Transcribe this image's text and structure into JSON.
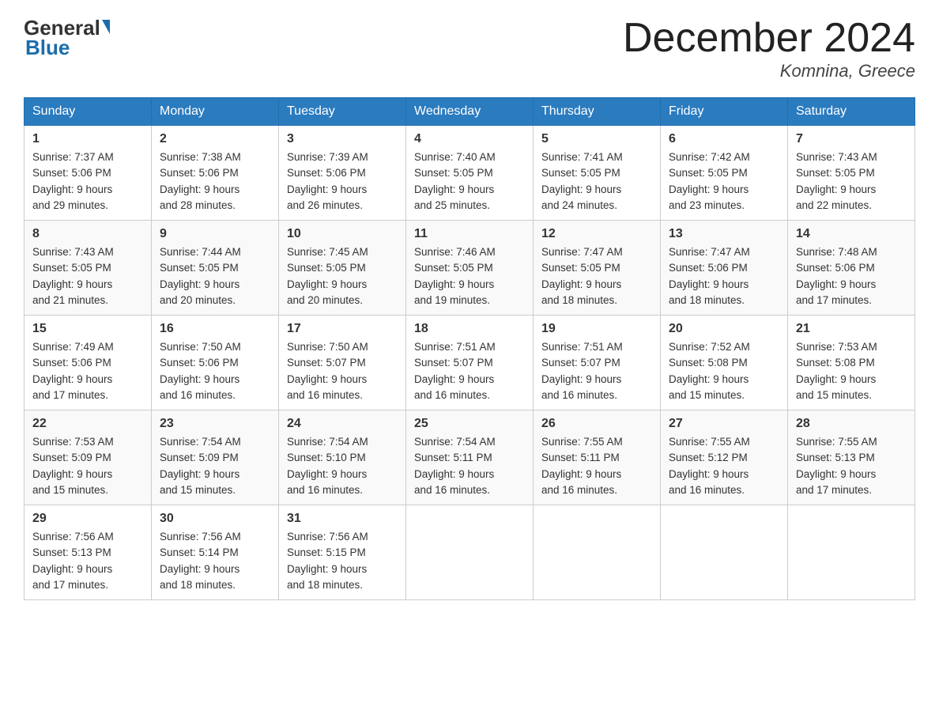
{
  "header": {
    "logo_general": "General",
    "logo_blue": "Blue",
    "month_title": "December 2024",
    "location": "Komnina, Greece"
  },
  "weekdays": [
    "Sunday",
    "Monday",
    "Tuesday",
    "Wednesday",
    "Thursday",
    "Friday",
    "Saturday"
  ],
  "weeks": [
    [
      {
        "day": "1",
        "sunrise": "Sunrise: 7:37 AM",
        "sunset": "Sunset: 5:06 PM",
        "daylight": "Daylight: 9 hours",
        "minutes": "and 29 minutes."
      },
      {
        "day": "2",
        "sunrise": "Sunrise: 7:38 AM",
        "sunset": "Sunset: 5:06 PM",
        "daylight": "Daylight: 9 hours",
        "minutes": "and 28 minutes."
      },
      {
        "day": "3",
        "sunrise": "Sunrise: 7:39 AM",
        "sunset": "Sunset: 5:06 PM",
        "daylight": "Daylight: 9 hours",
        "minutes": "and 26 minutes."
      },
      {
        "day": "4",
        "sunrise": "Sunrise: 7:40 AM",
        "sunset": "Sunset: 5:05 PM",
        "daylight": "Daylight: 9 hours",
        "minutes": "and 25 minutes."
      },
      {
        "day": "5",
        "sunrise": "Sunrise: 7:41 AM",
        "sunset": "Sunset: 5:05 PM",
        "daylight": "Daylight: 9 hours",
        "minutes": "and 24 minutes."
      },
      {
        "day": "6",
        "sunrise": "Sunrise: 7:42 AM",
        "sunset": "Sunset: 5:05 PM",
        "daylight": "Daylight: 9 hours",
        "minutes": "and 23 minutes."
      },
      {
        "day": "7",
        "sunrise": "Sunrise: 7:43 AM",
        "sunset": "Sunset: 5:05 PM",
        "daylight": "Daylight: 9 hours",
        "minutes": "and 22 minutes."
      }
    ],
    [
      {
        "day": "8",
        "sunrise": "Sunrise: 7:43 AM",
        "sunset": "Sunset: 5:05 PM",
        "daylight": "Daylight: 9 hours",
        "minutes": "and 21 minutes."
      },
      {
        "day": "9",
        "sunrise": "Sunrise: 7:44 AM",
        "sunset": "Sunset: 5:05 PM",
        "daylight": "Daylight: 9 hours",
        "minutes": "and 20 minutes."
      },
      {
        "day": "10",
        "sunrise": "Sunrise: 7:45 AM",
        "sunset": "Sunset: 5:05 PM",
        "daylight": "Daylight: 9 hours",
        "minutes": "and 20 minutes."
      },
      {
        "day": "11",
        "sunrise": "Sunrise: 7:46 AM",
        "sunset": "Sunset: 5:05 PM",
        "daylight": "Daylight: 9 hours",
        "minutes": "and 19 minutes."
      },
      {
        "day": "12",
        "sunrise": "Sunrise: 7:47 AM",
        "sunset": "Sunset: 5:05 PM",
        "daylight": "Daylight: 9 hours",
        "minutes": "and 18 minutes."
      },
      {
        "day": "13",
        "sunrise": "Sunrise: 7:47 AM",
        "sunset": "Sunset: 5:06 PM",
        "daylight": "Daylight: 9 hours",
        "minutes": "and 18 minutes."
      },
      {
        "day": "14",
        "sunrise": "Sunrise: 7:48 AM",
        "sunset": "Sunset: 5:06 PM",
        "daylight": "Daylight: 9 hours",
        "minutes": "and 17 minutes."
      }
    ],
    [
      {
        "day": "15",
        "sunrise": "Sunrise: 7:49 AM",
        "sunset": "Sunset: 5:06 PM",
        "daylight": "Daylight: 9 hours",
        "minutes": "and 17 minutes."
      },
      {
        "day": "16",
        "sunrise": "Sunrise: 7:50 AM",
        "sunset": "Sunset: 5:06 PM",
        "daylight": "Daylight: 9 hours",
        "minutes": "and 16 minutes."
      },
      {
        "day": "17",
        "sunrise": "Sunrise: 7:50 AM",
        "sunset": "Sunset: 5:07 PM",
        "daylight": "Daylight: 9 hours",
        "minutes": "and 16 minutes."
      },
      {
        "day": "18",
        "sunrise": "Sunrise: 7:51 AM",
        "sunset": "Sunset: 5:07 PM",
        "daylight": "Daylight: 9 hours",
        "minutes": "and 16 minutes."
      },
      {
        "day": "19",
        "sunrise": "Sunrise: 7:51 AM",
        "sunset": "Sunset: 5:07 PM",
        "daylight": "Daylight: 9 hours",
        "minutes": "and 16 minutes."
      },
      {
        "day": "20",
        "sunrise": "Sunrise: 7:52 AM",
        "sunset": "Sunset: 5:08 PM",
        "daylight": "Daylight: 9 hours",
        "minutes": "and 15 minutes."
      },
      {
        "day": "21",
        "sunrise": "Sunrise: 7:53 AM",
        "sunset": "Sunset: 5:08 PM",
        "daylight": "Daylight: 9 hours",
        "minutes": "and 15 minutes."
      }
    ],
    [
      {
        "day": "22",
        "sunrise": "Sunrise: 7:53 AM",
        "sunset": "Sunset: 5:09 PM",
        "daylight": "Daylight: 9 hours",
        "minutes": "and 15 minutes."
      },
      {
        "day": "23",
        "sunrise": "Sunrise: 7:54 AM",
        "sunset": "Sunset: 5:09 PM",
        "daylight": "Daylight: 9 hours",
        "minutes": "and 15 minutes."
      },
      {
        "day": "24",
        "sunrise": "Sunrise: 7:54 AM",
        "sunset": "Sunset: 5:10 PM",
        "daylight": "Daylight: 9 hours",
        "minutes": "and 16 minutes."
      },
      {
        "day": "25",
        "sunrise": "Sunrise: 7:54 AM",
        "sunset": "Sunset: 5:11 PM",
        "daylight": "Daylight: 9 hours",
        "minutes": "and 16 minutes."
      },
      {
        "day": "26",
        "sunrise": "Sunrise: 7:55 AM",
        "sunset": "Sunset: 5:11 PM",
        "daylight": "Daylight: 9 hours",
        "minutes": "and 16 minutes."
      },
      {
        "day": "27",
        "sunrise": "Sunrise: 7:55 AM",
        "sunset": "Sunset: 5:12 PM",
        "daylight": "Daylight: 9 hours",
        "minutes": "and 16 minutes."
      },
      {
        "day": "28",
        "sunrise": "Sunrise: 7:55 AM",
        "sunset": "Sunset: 5:13 PM",
        "daylight": "Daylight: 9 hours",
        "minutes": "and 17 minutes."
      }
    ],
    [
      {
        "day": "29",
        "sunrise": "Sunrise: 7:56 AM",
        "sunset": "Sunset: 5:13 PM",
        "daylight": "Daylight: 9 hours",
        "minutes": "and 17 minutes."
      },
      {
        "day": "30",
        "sunrise": "Sunrise: 7:56 AM",
        "sunset": "Sunset: 5:14 PM",
        "daylight": "Daylight: 9 hours",
        "minutes": "and 18 minutes."
      },
      {
        "day": "31",
        "sunrise": "Sunrise: 7:56 AM",
        "sunset": "Sunset: 5:15 PM",
        "daylight": "Daylight: 9 hours",
        "minutes": "and 18 minutes."
      },
      null,
      null,
      null,
      null
    ]
  ]
}
